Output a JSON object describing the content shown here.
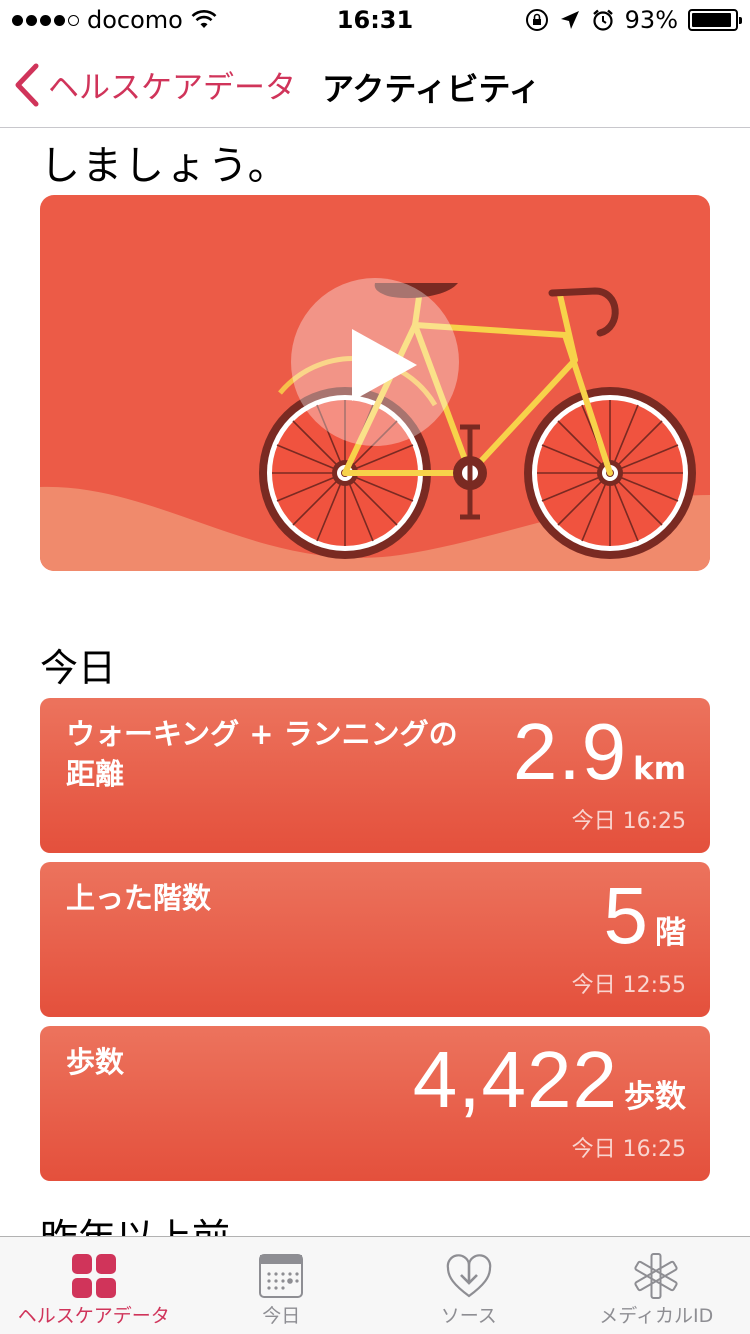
{
  "status_bar": {
    "carrier": "docomo",
    "time": "16:31",
    "battery_percent": "93%",
    "battery_level": 0.93,
    "signal_bars_filled": 4,
    "signal_bars_total": 5
  },
  "nav": {
    "back_label": "ヘルスケアデータ",
    "title": "アクティビティ",
    "accent_color": "#d0345a"
  },
  "intro_text": "しましょう。",
  "video": {
    "icon": "play-icon",
    "illustration": "bicycle"
  },
  "section_today": "今日",
  "metrics": [
    {
      "label": "ウォーキング + ランニングの距離",
      "value": "2.9",
      "unit": "km",
      "time": "今日 16:25"
    },
    {
      "label": "上った階数",
      "value": "5",
      "unit": "階",
      "time": "今日 12:55"
    },
    {
      "label": "歩数",
      "value": "4,422",
      "unit": "歩数",
      "time": "今日 16:25"
    }
  ],
  "section_lastyear": "昨年以上前",
  "tabs": [
    {
      "label": "ヘルスケアデータ",
      "icon": "health-data-grid-icon",
      "active": true
    },
    {
      "label": "今日",
      "icon": "calendar-icon",
      "active": false
    },
    {
      "label": "ソース",
      "icon": "sources-heart-icon",
      "active": false
    },
    {
      "label": "メディカルID",
      "icon": "medical-id-icon",
      "active": false
    }
  ]
}
